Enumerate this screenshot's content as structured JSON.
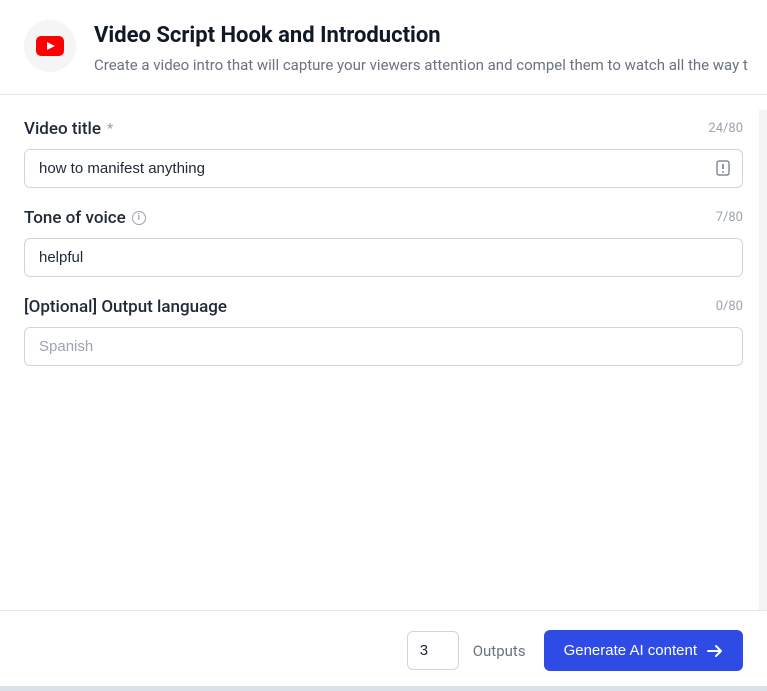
{
  "header": {
    "title": "Video Script Hook and Introduction",
    "subtitle": "Create a video intro that will capture your viewers attention and compel them to watch all the way t"
  },
  "fields": {
    "video_title": {
      "label": "Video title",
      "required_mark": "*",
      "value": "how to manifest anything",
      "counter": "24/80"
    },
    "tone": {
      "label": "Tone of voice",
      "value": "helpful",
      "counter": "7/80"
    },
    "language": {
      "label": "[Optional] Output language",
      "placeholder": "Spanish",
      "value": "",
      "counter": "0/80"
    }
  },
  "footer": {
    "outputs_value": "3",
    "outputs_label": "Outputs",
    "generate_label": "Generate AI content"
  }
}
